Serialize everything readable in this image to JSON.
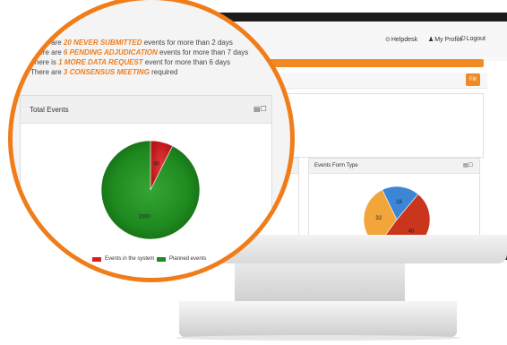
{
  "header": {
    "helpdesk": "Helpdesk",
    "my_profile": "My Profile",
    "logout": "Logout"
  },
  "filter": {
    "button": "Fill"
  },
  "alerts": [
    {
      "prefix": "There are ",
      "highlight": "20 NEVER SUBMITTED",
      "suffix": " events for more than 2 days"
    },
    {
      "prefix": "There are ",
      "highlight": "6 PENDING ADJUDICATION",
      "suffix": " events for more than 7 days"
    },
    {
      "prefix": "There is ",
      "highlight": "1 MORE DATA REQUEST",
      "suffix": " event for more than 6 days"
    },
    {
      "prefix": "There are ",
      "highlight": "3 CONSENSUS MEETING",
      "suffix": " required"
    }
  ],
  "total_events_panel": {
    "title": "Total Events",
    "legend": {
      "system": "Events in the system",
      "planned": "Planned events"
    }
  },
  "form_type_panel": {
    "title": "Events Form Type"
  },
  "colors": {
    "accent": "#f07d1a",
    "pie_red": "#d81e1e",
    "pie_green": "#1f8a1f"
  },
  "chart_data": [
    {
      "type": "pie",
      "title": "Total Events",
      "series": [
        {
          "name": "Events in the system",
          "values": [
            80
          ]
        },
        {
          "name": "Planned events",
          "values": [
            1000
          ]
        }
      ],
      "data_labels": [
        "80",
        "1000"
      ],
      "legend_position": "bottom"
    },
    {
      "type": "pie",
      "title": "Events Form Type",
      "categories": [
        "red",
        "orange",
        "blue"
      ],
      "values": [
        48,
        32,
        18
      ],
      "data_labels": [
        "48",
        "32",
        "18"
      ]
    }
  ]
}
